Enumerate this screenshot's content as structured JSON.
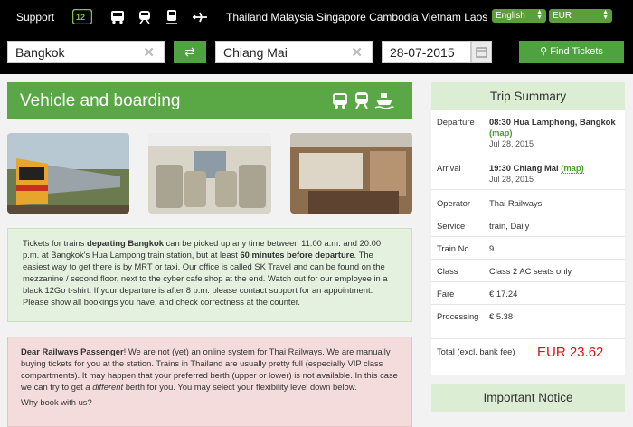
{
  "nav": {
    "support": "Support",
    "countries": "Thailand  Malaysia  Singapore  Cambodia  Vietnam  Laos",
    "language": "English",
    "currency": "EUR",
    "logo_icon": "12go-logo",
    "modes": [
      "bus-icon",
      "train-icon",
      "train-front-icon",
      "ferry-icon",
      "plane-icon"
    ]
  },
  "search": {
    "from": "Bangkok",
    "to": "Chiang Mai",
    "date": "28-07-2015",
    "find_label": "Find Tickets",
    "clear": "✕"
  },
  "vehicle": {
    "title": "Vehicle and boarding",
    "icons": [
      "bus-icon",
      "train-icon",
      "ferry-icon"
    ]
  },
  "info": {
    "p1": "Tickets for trains ",
    "p1b": "departing Bangkok",
    "p2": " can be picked up any time between 11:00 a.m. and 20:00 p.m. at Bangkok's Hua Lampong train station, but at least ",
    "p2b": "60 minutes before departure",
    "p3": ". The easiest way to get there is by MRT or taxi. Our office is called SK Travel and can be found on the mezzanine / second floor, next to the cyber cafe shop at the end. Watch out for our employee in a black 12Go t-shirt. If your departure is after 8 p.m. please contact support for an appointment. Please show all bookings you have, and check correctness at the counter."
  },
  "warning": {
    "title": "Dear Railways Passenger",
    "p1": "! We are not (yet) an online system for Thai Railways. We are manually buying tickets for you at the station. Trains in Thailand are usually pretty full (especially VIP class compartments). It may happen that your preferred berth (upper or lower) is not available. In this case we can try to get ",
    "p1i": "a different",
    "p2": " berth for you. You may select your flexibility level down below.",
    "why": "Why book with us?"
  },
  "summary": {
    "title": "Trip Summary",
    "departure_label": "Departure",
    "departure_value": "08:30 Hua Lamphong, Bangkok",
    "departure_date": "Jul 28, 2015",
    "arrival_label": "Arrival",
    "arrival_value": "19:30 Chiang Mai",
    "arrival_date": "Jul 28, 2015",
    "map_label": "(map)",
    "operator_label": "Operator",
    "operator_value": "Thai Railways",
    "service_label": "Service",
    "service_value": "train, Daily",
    "train_label": "Train No.",
    "train_value": "9",
    "class_label": "Class",
    "class_value": "Class 2 AC seats only",
    "fare_label": "Fare",
    "fare_value": "€ 17.24",
    "processing_label": "Processing",
    "processing_value": "€ 5.38",
    "total_label": "Total (excl. bank fee)",
    "total_value": "EUR 23.62"
  },
  "notice": {
    "title": "Important Notice"
  }
}
